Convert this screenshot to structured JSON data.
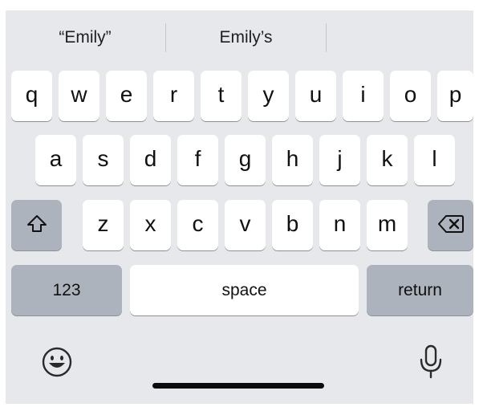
{
  "suggestions": [
    "“Emily”",
    "Emily’s",
    ""
  ],
  "rows": {
    "row1": [
      "q",
      "w",
      "e",
      "r",
      "t",
      "y",
      "u",
      "i",
      "o",
      "p"
    ],
    "row2": [
      "a",
      "s",
      "d",
      "f",
      "g",
      "h",
      "j",
      "k",
      "l"
    ],
    "row3": [
      "z",
      "x",
      "c",
      "v",
      "b",
      "n",
      "m"
    ]
  },
  "bottom_row": {
    "numbers_label": "123",
    "space_label": "space",
    "return_label": "return"
  },
  "icons": {
    "shift": "shift-icon",
    "delete": "delete-backspace-icon",
    "emoji": "emoji-icon",
    "dictation": "microphone-icon"
  },
  "colors": {
    "keyboard_background": "#e6e8ec",
    "letter_key": "#ffffff",
    "function_key": "#adb3bd"
  }
}
